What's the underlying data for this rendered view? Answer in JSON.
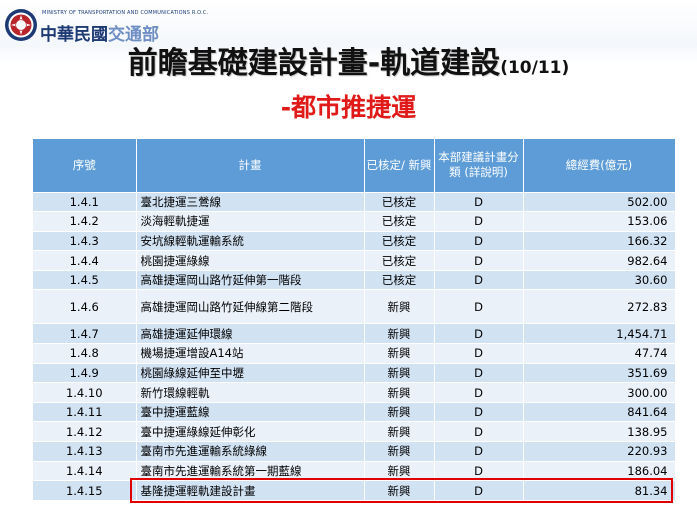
{
  "header": {
    "ministry_en": "MINISTRY OF TRANSPORTATION AND COMMUNICATIONS R.O.C.",
    "ministry_zh_dark": "中華民國",
    "ministry_zh_light": "交通部",
    "logo_icon": "ministry-seal-icon"
  },
  "title": {
    "main": "前瞻基礎建設計畫-軌道建設",
    "page": "(10/11)",
    "subtitle": "-都市推捷運"
  },
  "table": {
    "headers": {
      "seq": "序號",
      "plan": "計畫",
      "status": "已核定/ 新興",
      "class": "本部建議計畫分類 (詳說明)",
      "cost": "總經費(億元)"
    },
    "rows": [
      {
        "seq": "1.4.1",
        "plan": "臺北捷運三鶯線",
        "status": "已核定",
        "class": "D",
        "cost": "502.00"
      },
      {
        "seq": "1.4.2",
        "plan": "淡海輕軌捷運",
        "status": "已核定",
        "class": "D",
        "cost": "153.06"
      },
      {
        "seq": "1.4.3",
        "plan": "安坑線輕軌運輸系統",
        "status": "已核定",
        "class": "D",
        "cost": "166.32"
      },
      {
        "seq": "1.4.4",
        "plan": "桃園捷運綠線",
        "status": "已核定",
        "class": "D",
        "cost": "982.64"
      },
      {
        "seq": "1.4.5",
        "plan": "高雄捷運岡山路竹延伸第一階段",
        "status": "已核定",
        "class": "D",
        "cost": "30.60"
      },
      {
        "seq": "1.4.6",
        "plan": "高雄捷運岡山路竹延伸線第二階段",
        "status": "新興",
        "class": "D",
        "cost": "272.83"
      },
      {
        "seq": "1.4.7",
        "plan": "高雄捷運延伸環線",
        "status": "新興",
        "class": "D",
        "cost": "1,454.71"
      },
      {
        "seq": "1.4.8",
        "plan": "機場捷運增設A14站",
        "status": "新興",
        "class": "D",
        "cost": "47.74"
      },
      {
        "seq": "1.4.9",
        "plan": "桃園綠線延伸至中壢",
        "status": "新興",
        "class": "D",
        "cost": "351.69"
      },
      {
        "seq": "1.4.10",
        "plan": "新竹環線輕軌",
        "status": "新興",
        "class": "D",
        "cost": "300.00"
      },
      {
        "seq": "1.4.11",
        "plan": "臺中捷運藍線",
        "status": "新興",
        "class": "D",
        "cost": "841.64"
      },
      {
        "seq": "1.4.12",
        "plan": "臺中捷運綠線延伸彰化",
        "status": "新興",
        "class": "D",
        "cost": "138.95"
      },
      {
        "seq": "1.4.13",
        "plan": "臺南市先進運輸系統綠線",
        "status": "新興",
        "class": "D",
        "cost": "220.93"
      },
      {
        "seq": "1.4.14",
        "plan": "臺南市先進運輸系統第一期藍線",
        "status": "新興",
        "class": "D",
        "cost": "186.04"
      },
      {
        "seq": "1.4.15",
        "plan": "基隆捷運輕軌建設計畫",
        "status": "新興",
        "class": "D",
        "cost": "81.34"
      }
    ]
  },
  "colors": {
    "header_bg": "#5d9cd6",
    "row_odd": "#d1e2f3",
    "row_even": "#eaf1f9",
    "subtitle": "#e01919",
    "highlight_border": "#e00000"
  }
}
